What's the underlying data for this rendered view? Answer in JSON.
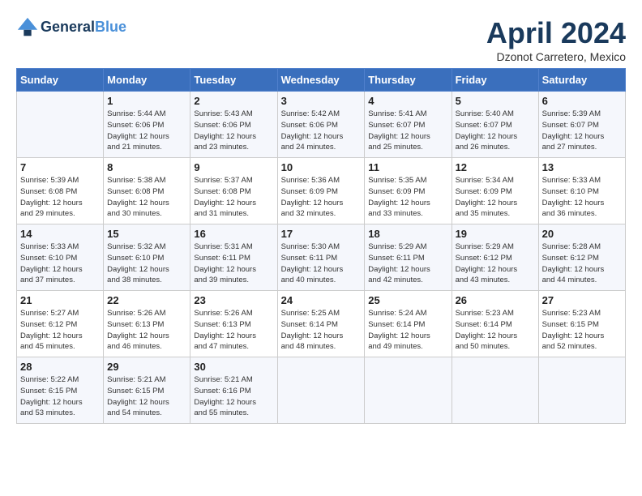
{
  "header": {
    "logo_line1": "General",
    "logo_line2": "Blue",
    "month": "April 2024",
    "location": "Dzonot Carretero, Mexico"
  },
  "weekdays": [
    "Sunday",
    "Monday",
    "Tuesday",
    "Wednesday",
    "Thursday",
    "Friday",
    "Saturday"
  ],
  "weeks": [
    [
      {
        "day": "",
        "info": ""
      },
      {
        "day": "1",
        "info": "Sunrise: 5:44 AM\nSunset: 6:06 PM\nDaylight: 12 hours\nand 21 minutes."
      },
      {
        "day": "2",
        "info": "Sunrise: 5:43 AM\nSunset: 6:06 PM\nDaylight: 12 hours\nand 23 minutes."
      },
      {
        "day": "3",
        "info": "Sunrise: 5:42 AM\nSunset: 6:06 PM\nDaylight: 12 hours\nand 24 minutes."
      },
      {
        "day": "4",
        "info": "Sunrise: 5:41 AM\nSunset: 6:07 PM\nDaylight: 12 hours\nand 25 minutes."
      },
      {
        "day": "5",
        "info": "Sunrise: 5:40 AM\nSunset: 6:07 PM\nDaylight: 12 hours\nand 26 minutes."
      },
      {
        "day": "6",
        "info": "Sunrise: 5:39 AM\nSunset: 6:07 PM\nDaylight: 12 hours\nand 27 minutes."
      }
    ],
    [
      {
        "day": "7",
        "info": "Sunrise: 5:39 AM\nSunset: 6:08 PM\nDaylight: 12 hours\nand 29 minutes."
      },
      {
        "day": "8",
        "info": "Sunrise: 5:38 AM\nSunset: 6:08 PM\nDaylight: 12 hours\nand 30 minutes."
      },
      {
        "day": "9",
        "info": "Sunrise: 5:37 AM\nSunset: 6:08 PM\nDaylight: 12 hours\nand 31 minutes."
      },
      {
        "day": "10",
        "info": "Sunrise: 5:36 AM\nSunset: 6:09 PM\nDaylight: 12 hours\nand 32 minutes."
      },
      {
        "day": "11",
        "info": "Sunrise: 5:35 AM\nSunset: 6:09 PM\nDaylight: 12 hours\nand 33 minutes."
      },
      {
        "day": "12",
        "info": "Sunrise: 5:34 AM\nSunset: 6:09 PM\nDaylight: 12 hours\nand 35 minutes."
      },
      {
        "day": "13",
        "info": "Sunrise: 5:33 AM\nSunset: 6:10 PM\nDaylight: 12 hours\nand 36 minutes."
      }
    ],
    [
      {
        "day": "14",
        "info": "Sunrise: 5:33 AM\nSunset: 6:10 PM\nDaylight: 12 hours\nand 37 minutes."
      },
      {
        "day": "15",
        "info": "Sunrise: 5:32 AM\nSunset: 6:10 PM\nDaylight: 12 hours\nand 38 minutes."
      },
      {
        "day": "16",
        "info": "Sunrise: 5:31 AM\nSunset: 6:11 PM\nDaylight: 12 hours\nand 39 minutes."
      },
      {
        "day": "17",
        "info": "Sunrise: 5:30 AM\nSunset: 6:11 PM\nDaylight: 12 hours\nand 40 minutes."
      },
      {
        "day": "18",
        "info": "Sunrise: 5:29 AM\nSunset: 6:11 PM\nDaylight: 12 hours\nand 42 minutes."
      },
      {
        "day": "19",
        "info": "Sunrise: 5:29 AM\nSunset: 6:12 PM\nDaylight: 12 hours\nand 43 minutes."
      },
      {
        "day": "20",
        "info": "Sunrise: 5:28 AM\nSunset: 6:12 PM\nDaylight: 12 hours\nand 44 minutes."
      }
    ],
    [
      {
        "day": "21",
        "info": "Sunrise: 5:27 AM\nSunset: 6:12 PM\nDaylight: 12 hours\nand 45 minutes."
      },
      {
        "day": "22",
        "info": "Sunrise: 5:26 AM\nSunset: 6:13 PM\nDaylight: 12 hours\nand 46 minutes."
      },
      {
        "day": "23",
        "info": "Sunrise: 5:26 AM\nSunset: 6:13 PM\nDaylight: 12 hours\nand 47 minutes."
      },
      {
        "day": "24",
        "info": "Sunrise: 5:25 AM\nSunset: 6:14 PM\nDaylight: 12 hours\nand 48 minutes."
      },
      {
        "day": "25",
        "info": "Sunrise: 5:24 AM\nSunset: 6:14 PM\nDaylight: 12 hours\nand 49 minutes."
      },
      {
        "day": "26",
        "info": "Sunrise: 5:23 AM\nSunset: 6:14 PM\nDaylight: 12 hours\nand 50 minutes."
      },
      {
        "day": "27",
        "info": "Sunrise: 5:23 AM\nSunset: 6:15 PM\nDaylight: 12 hours\nand 52 minutes."
      }
    ],
    [
      {
        "day": "28",
        "info": "Sunrise: 5:22 AM\nSunset: 6:15 PM\nDaylight: 12 hours\nand 53 minutes."
      },
      {
        "day": "29",
        "info": "Sunrise: 5:21 AM\nSunset: 6:15 PM\nDaylight: 12 hours\nand 54 minutes."
      },
      {
        "day": "30",
        "info": "Sunrise: 5:21 AM\nSunset: 6:16 PM\nDaylight: 12 hours\nand 55 minutes."
      },
      {
        "day": "",
        "info": ""
      },
      {
        "day": "",
        "info": ""
      },
      {
        "day": "",
        "info": ""
      },
      {
        "day": "",
        "info": ""
      }
    ]
  ]
}
